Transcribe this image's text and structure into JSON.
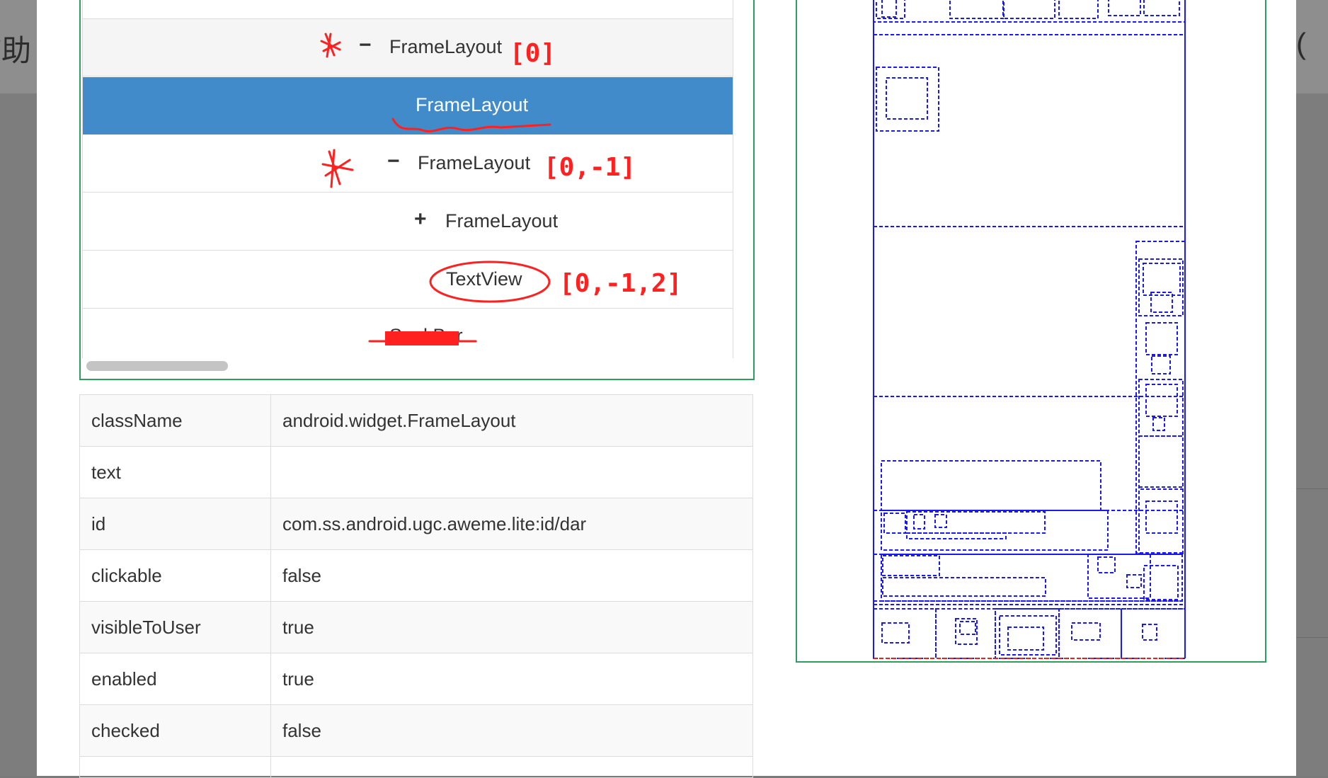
{
  "background": {
    "left_text": "辅助",
    "right_text": "("
  },
  "tree": {
    "nodes": [
      {
        "label": "FrameLayout",
        "toggle": "−",
        "state": "expanded"
      },
      {
        "label": "FrameLayout",
        "toggle": "",
        "state": "selected"
      },
      {
        "label": "FrameLayout",
        "toggle": "−",
        "state": "expanded"
      },
      {
        "label": "FrameLayout",
        "toggle": "+",
        "state": "collapsed"
      },
      {
        "label": "TextView",
        "toggle": "",
        "state": "leaf"
      },
      {
        "label": "SeekBar",
        "toggle": "",
        "state": "leaf"
      }
    ]
  },
  "annotations": {
    "index_1": "[0]",
    "index_2": "[0,-1]",
    "index_3": "[0,-1,2]"
  },
  "properties": [
    {
      "key": "className",
      "value": "android.widget.FrameLayout"
    },
    {
      "key": "text",
      "value": ""
    },
    {
      "key": "id",
      "value": "com.ss.android.ugc.aweme.lite:id/dar"
    },
    {
      "key": "clickable",
      "value": "false"
    },
    {
      "key": "visibleToUser",
      "value": "true"
    },
    {
      "key": "enabled",
      "value": "true"
    },
    {
      "key": "checked",
      "value": "false"
    }
  ],
  "colors": {
    "selected": "#428bca",
    "panel_border": "#2e9e5e",
    "annotation": "#ff2020",
    "wireframe": "#0000ee"
  }
}
